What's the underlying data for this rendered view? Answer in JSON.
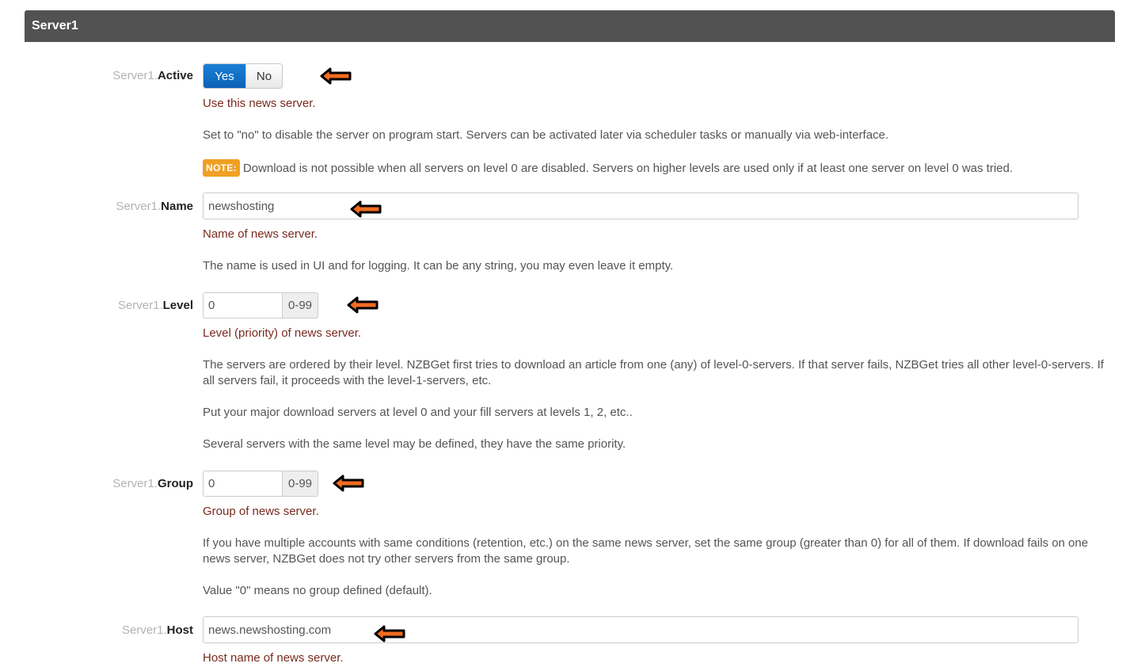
{
  "section": {
    "title": "Server1"
  },
  "colors": {
    "header_bg": "#525252",
    "active_toggle": "#0b62b8",
    "desc_red": "#7a2a1e",
    "note_badge": "#f0a023",
    "arrow_fill": "#f26d21"
  },
  "icons": {
    "annotation": "left-arrow-icon"
  },
  "fields": {
    "active": {
      "prefix": "Server1.",
      "name": "Active",
      "options": [
        "Yes",
        "No"
      ],
      "selected": "Yes",
      "desc": "Use this news server.",
      "details": "Set to \"no\" to disable the server on program start. Servers can be activated later via scheduler tasks or manually via web-interface.",
      "note_label": "NOTE:",
      "note_text": "Download is not possible when all servers on level 0 are disabled. Servers on higher levels are used only if at least one server on level 0 was tried."
    },
    "name": {
      "prefix": "Server1.",
      "name": "Name",
      "value": "newshosting",
      "desc": "Name of news server.",
      "details": "The name is used in UI and for logging. It can be any string, you may even leave it empty."
    },
    "level": {
      "prefix": "Server1.",
      "name": "Level",
      "value": "0",
      "range": "0-99",
      "desc": "Level (priority) of news server.",
      "details1": "The servers are ordered by their level. NZBGet first tries to download an article from one (any) of level-0-servers. If that server fails, NZBGet tries all other level-0-servers. If all servers fail, it proceeds with the level-1-servers, etc.",
      "details2": "Put your major download servers at level 0 and your fill servers at levels 1, 2, etc..",
      "details3": "Several servers with the same level may be defined, they have the same priority."
    },
    "group": {
      "prefix": "Server1.",
      "name": "Group",
      "value": "0",
      "range": "0-99",
      "desc": "Group of news server.",
      "details1": "If you have multiple accounts with same conditions (retention, etc.) on the same news server, set the same group (greater than 0) for all of them. If download fails on one news server, NZBGet does not try other servers from the same group.",
      "details2": "Value \"0\" means no group defined (default)."
    },
    "host": {
      "prefix": "Server1.",
      "name": "Host",
      "value": "news.newshosting.com",
      "desc": "Host name of news server."
    }
  }
}
